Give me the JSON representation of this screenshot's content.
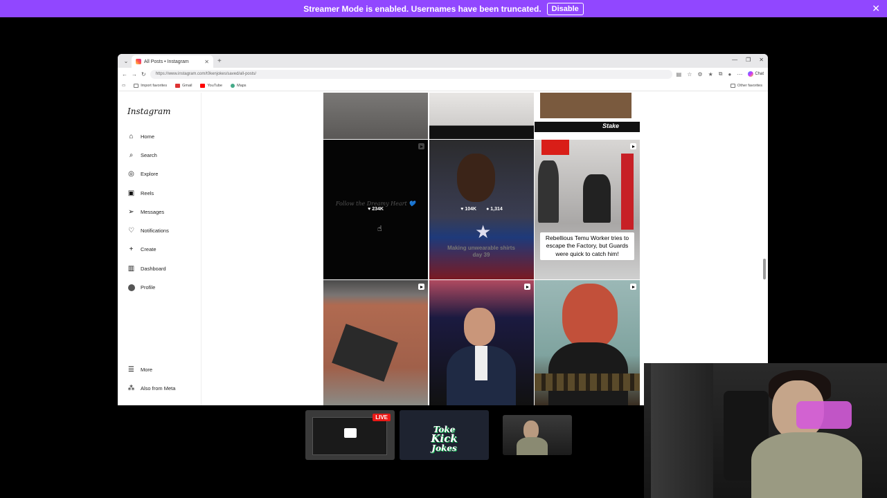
{
  "banner": {
    "message": "Streamer Mode is enabled. Usernames have been truncated.",
    "disable_label": "Disable",
    "close_glyph": "✕",
    "bg_color": "#9147ff"
  },
  "browser": {
    "tab_title": "All Posts • Instagram",
    "url": "https://www.instagram.com/t0kenjokes/saved/all-posts/",
    "copilot_label": "Chat",
    "bookmarks": [
      "Import favorites",
      "Gmail",
      "YouTube",
      "Maps"
    ],
    "other_favorites": "Other favorites"
  },
  "instagram": {
    "logo": "Instagram",
    "nav": [
      {
        "label": "Home",
        "icon": "home-icon"
      },
      {
        "label": "Search",
        "icon": "search-icon"
      },
      {
        "label": "Explore",
        "icon": "explore-icon"
      },
      {
        "label": "Reels",
        "icon": "reels-icon"
      },
      {
        "label": "Messages",
        "icon": "messages-icon"
      },
      {
        "label": "Notifications",
        "icon": "heart-icon"
      },
      {
        "label": "Create",
        "icon": "plus-icon"
      },
      {
        "label": "Dashboard",
        "icon": "dashboard-icon"
      },
      {
        "label": "Profile",
        "icon": "avatar-icon"
      }
    ],
    "more_label": "More",
    "meta_label": "Also from Meta",
    "posts": {
      "post1_likes": "234K",
      "post1_text": "Follow the Dreamy Heart 💙",
      "post2_likes": "104K",
      "post2_comments": "1,314",
      "post2_caption": "Making unwearable shirts day 39",
      "post3_caption": "Rebellious Temu Worker tries to escape the Factory, but Guards were quick to catch him!",
      "stake_text": "Stake"
    }
  },
  "stream": {
    "live_badge": "LIVE",
    "logo_line1": "Toke",
    "logo_line2": "Kick",
    "logo_line3": "Jokes"
  }
}
